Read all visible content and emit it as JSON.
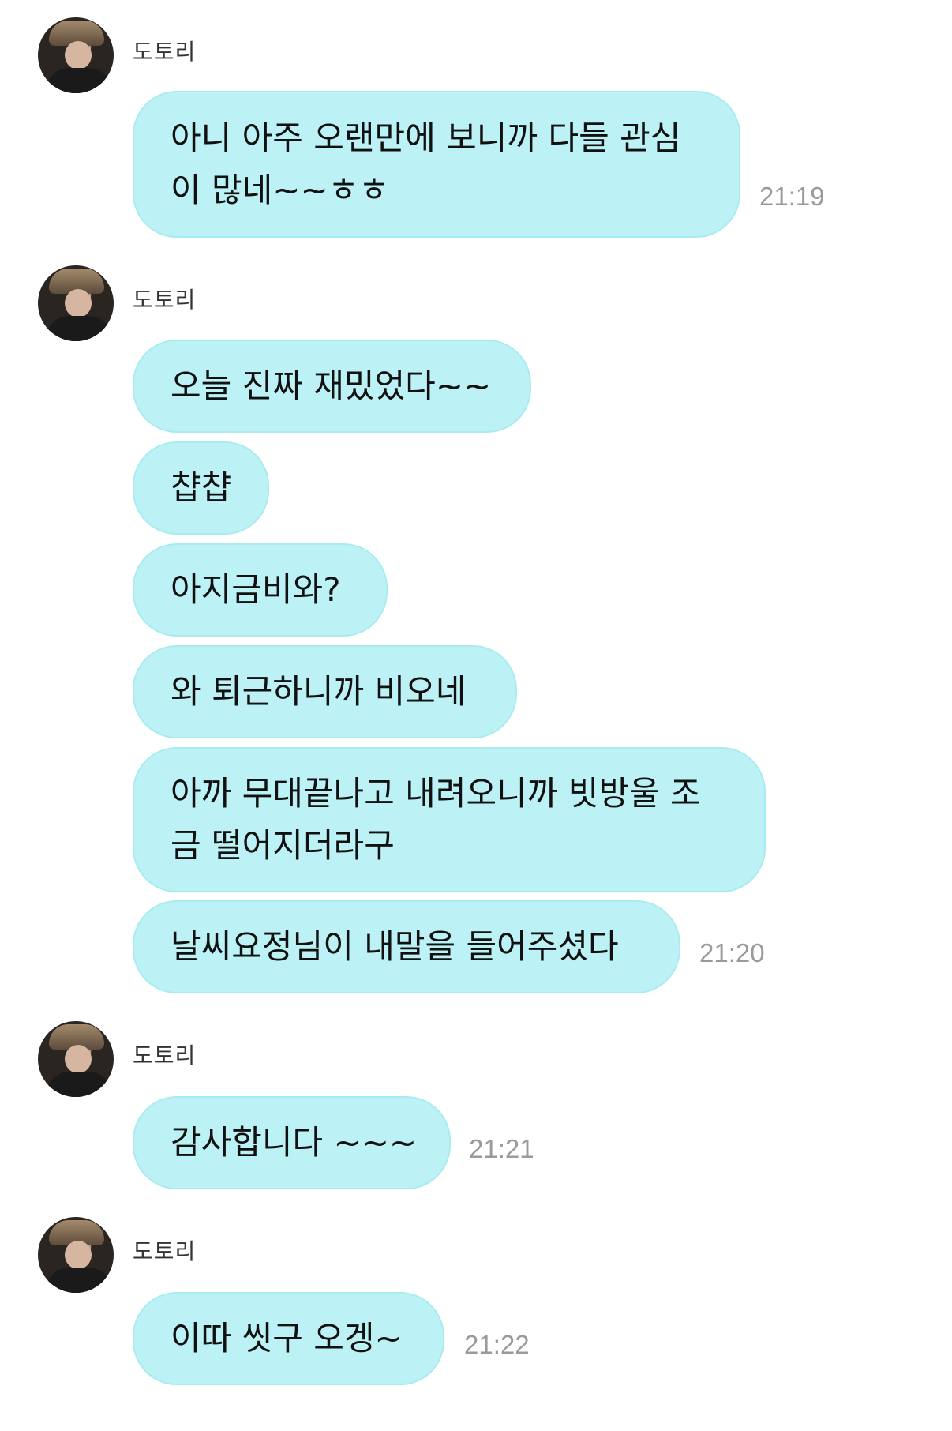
{
  "chat": {
    "groups": [
      {
        "sender": "도토리",
        "messages": [
          "아니 아주 오랜만에 보니까 다들 관심이 많네~~ㅎㅎ"
        ],
        "time": "21:19"
      },
      {
        "sender": "도토리",
        "messages": [
          "오늘 진짜 재밌었다~~",
          "챱챱",
          "아지금비와?",
          "와 퇴근하니까 비오네",
          "아까 무대끝나고 내려오니까 빗방울 조금 떨어지더라구",
          "날씨요정님이 내말을 들어주셨다"
        ],
        "time": "21:20"
      },
      {
        "sender": "도토리",
        "messages": [
          "감사합니다 ~~~"
        ],
        "time": "21:21"
      },
      {
        "sender": "도토리",
        "messages": [
          "이따 씻구 오겡~"
        ],
        "time": "21:22"
      }
    ]
  },
  "colors": {
    "bubble": "#bcf2f5",
    "time_text": "#9a9a9a",
    "sender_text": "#333333"
  }
}
